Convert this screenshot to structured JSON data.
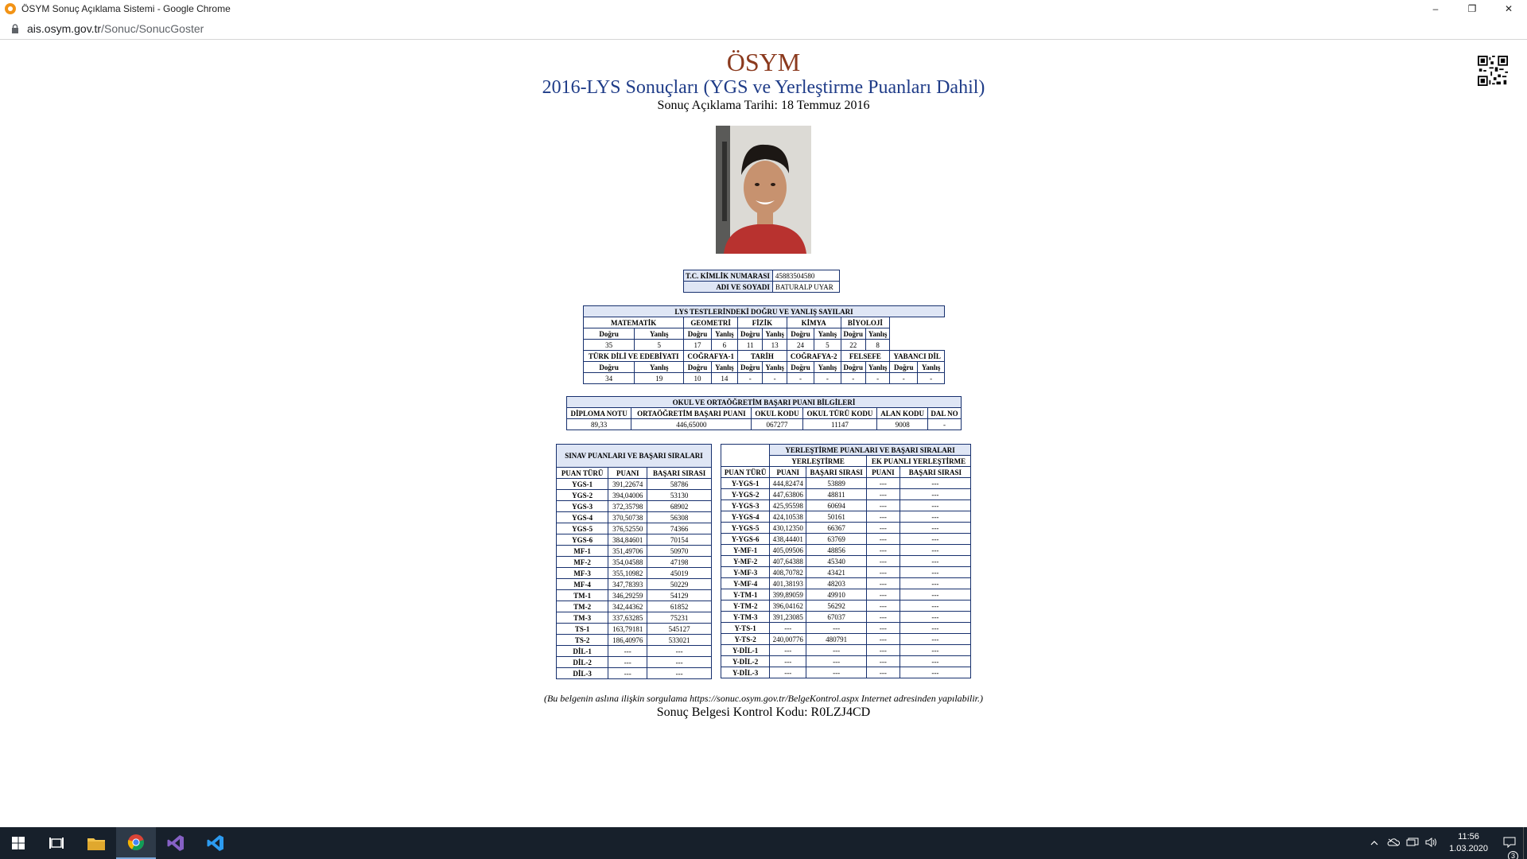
{
  "window": {
    "title": "ÖSYM Sonuç Açıklama Sistemi - Google Chrome",
    "minimize": "–",
    "maximize": "❐",
    "close": "✕"
  },
  "address": {
    "domain": "ais.osym.gov.tr",
    "path": "/Sonuc/SonucGoster"
  },
  "header": {
    "org": "ÖSYM",
    "title": "2016-LYS Sonuçları (YGS ve Yerleştirme Puanları Dahil)",
    "date": "Sonuç Açıklama Tarihi: 18 Temmuz 2016"
  },
  "identity": {
    "tc_label": "T.C. KİMLİK NUMARASI",
    "tc_value": "45883504580",
    "name_label": "ADI VE SOYADI",
    "name_value": "BATURALP UYAR"
  },
  "lys": {
    "title": "LYS TESTLERİNDEKİ DOĞRU VE YANLIŞ SAYILARI",
    "dogru": "Doğru",
    "yanlis": "Yanlış",
    "row1": [
      {
        "name": "MATEMATİK",
        "d": "35",
        "y": "5"
      },
      {
        "name": "GEOMETRİ",
        "d": "17",
        "y": "6"
      },
      {
        "name": "FİZİK",
        "d": "11",
        "y": "13"
      },
      {
        "name": "KİMYA",
        "d": "24",
        "y": "5"
      },
      {
        "name": "BİYOLOJİ",
        "d": "22",
        "y": "8"
      }
    ],
    "row2": [
      {
        "name": "TÜRK DİLİ VE EDEBİYATI",
        "d": "34",
        "y": "19"
      },
      {
        "name": "COĞRAFYA-1",
        "d": "10",
        "y": "14"
      },
      {
        "name": "TARİH",
        "d": "-",
        "y": "-"
      },
      {
        "name": "COĞRAFYA-2",
        "d": "-",
        "y": "-"
      },
      {
        "name": "FELSEFE",
        "d": "-",
        "y": "-"
      },
      {
        "name": "YABANCI DİL",
        "d": "-",
        "y": "-"
      }
    ]
  },
  "okul": {
    "title": "OKUL VE ORTAÖĞRETİM BAŞARI PUANI BİLGİLERİ",
    "headers": [
      "DİPLOMA NOTU",
      "ORTAÖĞRETİM BAŞARI PUANI",
      "OKUL KODU",
      "OKUL TÜRÜ KODU",
      "ALAN KODU",
      "DAL NO"
    ],
    "values": [
      "89,33",
      "446,65000",
      "067277",
      "11147",
      "9008",
      "-"
    ]
  },
  "sinav": {
    "title": "SINAV PUANLARI VE BAŞARI SIRALARI",
    "headers": [
      "PUAN TÜRÜ",
      "PUANI",
      "BAŞARI SIRASI"
    ],
    "rows": [
      [
        "YGS-1",
        "391,22674",
        "58786"
      ],
      [
        "YGS-2",
        "394,04006",
        "53130"
      ],
      [
        "YGS-3",
        "372,35798",
        "68902"
      ],
      [
        "YGS-4",
        "370,50738",
        "56308"
      ],
      [
        "YGS-5",
        "376,52550",
        "74366"
      ],
      [
        "YGS-6",
        "384,84601",
        "70154"
      ],
      [
        "MF-1",
        "351,49706",
        "50970"
      ],
      [
        "MF-2",
        "354,04588",
        "47198"
      ],
      [
        "MF-3",
        "355,10982",
        "45019"
      ],
      [
        "MF-4",
        "347,78393",
        "50229"
      ],
      [
        "TM-1",
        "346,29259",
        "54129"
      ],
      [
        "TM-2",
        "342,44362",
        "61852"
      ],
      [
        "TM-3",
        "337,63285",
        "75231"
      ],
      [
        "TS-1",
        "163,79181",
        "545127"
      ],
      [
        "TS-2",
        "186,40976",
        "533021"
      ],
      [
        "DİL-1",
        "---",
        "---"
      ],
      [
        "DİL-2",
        "---",
        "---"
      ],
      [
        "DİL-3",
        "---",
        "---"
      ]
    ]
  },
  "yerlestirme": {
    "title": "YERLEŞTİRME PUANLARI VE BAŞARI SIRALARI",
    "sub1": "YERLEŞTİRME",
    "sub2": "EK PUANLI YERLEŞTİRME",
    "headers": [
      "PUAN TÜRÜ",
      "PUANI",
      "BAŞARI SIRASI",
      "PUANI",
      "BAŞARI SIRASI"
    ],
    "rows": [
      [
        "Y-YGS-1",
        "444,82474",
        "53889",
        "---",
        "---"
      ],
      [
        "Y-YGS-2",
        "447,63806",
        "48811",
        "---",
        "---"
      ],
      [
        "Y-YGS-3",
        "425,95598",
        "60694",
        "---",
        "---"
      ],
      [
        "Y-YGS-4",
        "424,10538",
        "50161",
        "---",
        "---"
      ],
      [
        "Y-YGS-5",
        "430,12350",
        "66367",
        "---",
        "---"
      ],
      [
        "Y-YGS-6",
        "438,44401",
        "63769",
        "---",
        "---"
      ],
      [
        "Y-MF-1",
        "405,09506",
        "48856",
        "---",
        "---"
      ],
      [
        "Y-MF-2",
        "407,64388",
        "45340",
        "---",
        "---"
      ],
      [
        "Y-MF-3",
        "408,70782",
        "43421",
        "---",
        "---"
      ],
      [
        "Y-MF-4",
        "401,38193",
        "48203",
        "---",
        "---"
      ],
      [
        "Y-TM-1",
        "399,89059",
        "49910",
        "---",
        "---"
      ],
      [
        "Y-TM-2",
        "396,04162",
        "56292",
        "---",
        "---"
      ],
      [
        "Y-TM-3",
        "391,23085",
        "67037",
        "---",
        "---"
      ],
      [
        "Y-TS-1",
        "---",
        "---",
        "---",
        "---"
      ],
      [
        "Y-TS-2",
        "240,00776",
        "480791",
        "---",
        "---"
      ],
      [
        "Y-DİL-1",
        "---",
        "---",
        "---",
        "---"
      ],
      [
        "Y-DİL-2",
        "---",
        "---",
        "---",
        "---"
      ],
      [
        "Y-DİL-3",
        "---",
        "---",
        "---",
        "---"
      ]
    ]
  },
  "footer": {
    "note": "(Bu belgenin aslına ilişkin sorgulama https://sonuc.osym.gov.tr/BelgeKontrol.aspx Internet adresinden yapılabilir.)",
    "kontrol": "Sonuç Belgesi Kontrol Kodu: R0LZJ4CD"
  },
  "taskbar": {
    "time": "11:56",
    "date": "1.03.2020",
    "notifications": "3"
  },
  "colors": {
    "title": "#8b3a1e",
    "subtitle": "#1f3c88",
    "border": "#17306e",
    "taskbar": "#17202b"
  }
}
